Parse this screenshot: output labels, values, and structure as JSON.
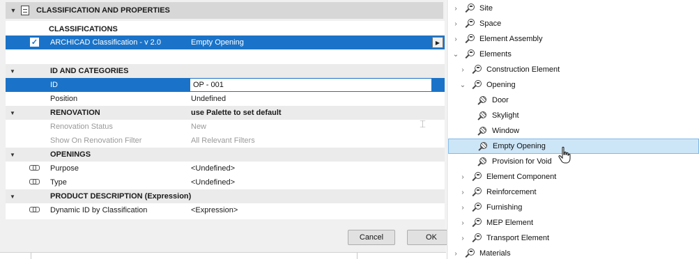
{
  "dialog": {
    "section_title": "CLASSIFICATION AND PROPERTIES",
    "classifications_header": "CLASSIFICATIONS",
    "classification_row": {
      "name": "ARCHICAD Classification - v 2.0",
      "value": "Empty Opening"
    },
    "groups": {
      "id_categories": "ID AND CATEGORIES",
      "renovation": "RENOVATION",
      "renovation_value": "use Palette to set default",
      "openings": "OPENINGS",
      "product_description": "PRODUCT DESCRIPTION (Expression)"
    },
    "rows": {
      "id": {
        "name": "ID",
        "value": "OP - 001"
      },
      "position": {
        "name": "Position",
        "value": "Undefined"
      },
      "renovation_status": {
        "name": "Renovation Status",
        "value": "New"
      },
      "show_on_filter": {
        "name": "Show On Renovation Filter",
        "value": "All Relevant Filters"
      },
      "purpose": {
        "name": "Purpose",
        "value": "<Undefined>"
      },
      "type": {
        "name": "Type",
        "value": "<Undefined>"
      },
      "dynamic_id": {
        "name": "Dynamic ID by Classification",
        "value": "<Expression>"
      }
    },
    "buttons": {
      "cancel": "Cancel",
      "ok": "OK"
    }
  },
  "tree": {
    "items": [
      {
        "label": "Site"
      },
      {
        "label": "Space"
      },
      {
        "label": "Element Assembly"
      },
      {
        "label": "Elements"
      },
      {
        "label": "Construction Element"
      },
      {
        "label": "Opening"
      },
      {
        "label": "Door"
      },
      {
        "label": "Skylight"
      },
      {
        "label": "Window"
      },
      {
        "label": "Empty Opening"
      },
      {
        "label": "Provision for Void"
      },
      {
        "label": "Element Component"
      },
      {
        "label": "Reinforcement"
      },
      {
        "label": "Furnishing"
      },
      {
        "label": "MEP Element"
      },
      {
        "label": "Transport Element"
      },
      {
        "label": "Materials"
      }
    ]
  },
  "colors": {
    "selection": "#1a73c8",
    "tree_selection": "#cde6f7",
    "group_bg": "#ebebeb"
  },
  "icons": {
    "section": "document-icon",
    "classification": "classification-icon",
    "leaf": "classification-leaf-icon",
    "link": "link-icon",
    "renovation": "renovation-icon"
  }
}
